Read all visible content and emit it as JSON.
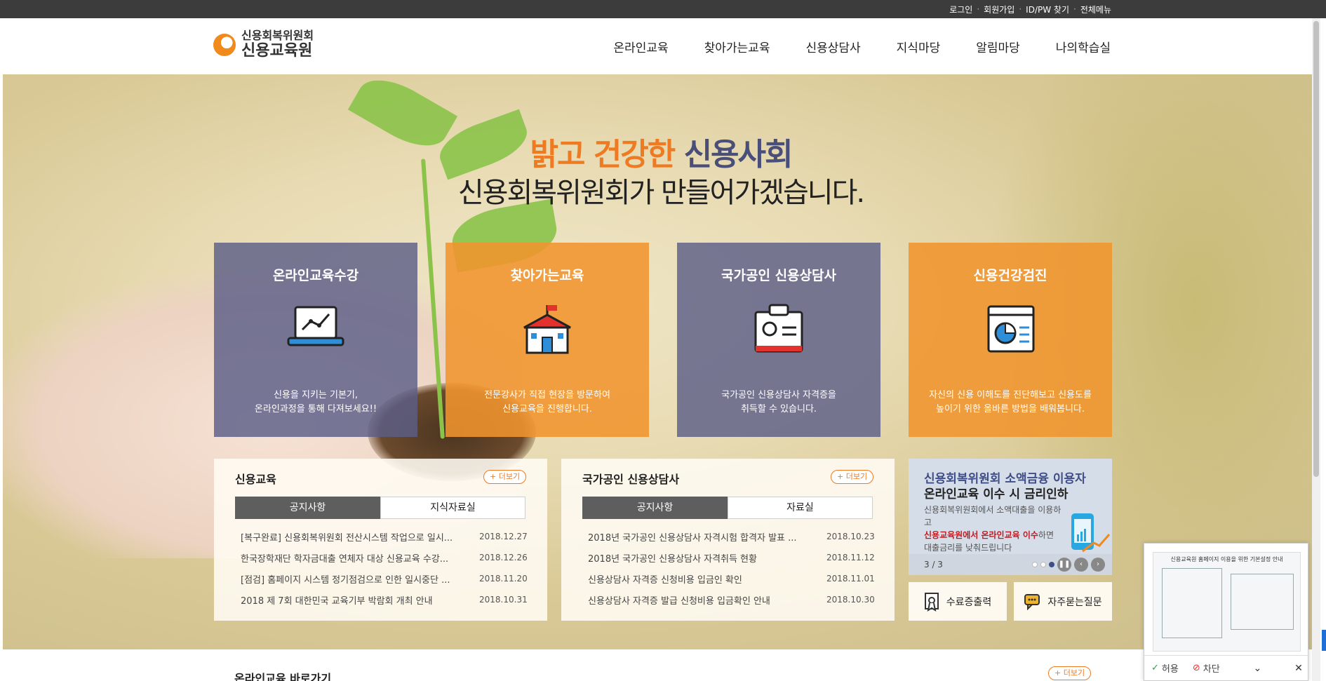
{
  "top_links": [
    "로그인",
    "회원가입",
    "ID/PW 찾기",
    "전체메뉴"
  ],
  "logo": {
    "line1": "신용회복위원회",
    "line2": "신용교육원"
  },
  "nav": [
    "온라인교육",
    "찾아가는교육",
    "신용상담사",
    "지식마당",
    "알림마당",
    "나의학습실"
  ],
  "hero": {
    "slogan_orange": "밝고 건강한",
    "slogan_blue": "신용사회",
    "slogan_line2": "신용회복위원회가 만들어가겠습니다."
  },
  "cards": [
    {
      "title": "온라인교육수강",
      "desc1": "신용을 지키는 기본기,",
      "desc2": "온라인과정을 통해 다져보세요!!",
      "icon": "laptop-icon"
    },
    {
      "title": "찾아가는교육",
      "desc1": "전문강사가 직접 현장을 방문하여",
      "desc2": "신용교육을 진행합니다.",
      "icon": "school-icon"
    },
    {
      "title": "국가공인 신용상담사",
      "desc1": "국가공인 신용상담사 자격증을",
      "desc2": "취득할 수 있습니다.",
      "icon": "id-card-icon"
    },
    {
      "title": "신용건강검진",
      "desc1": "자신의 신용 이해도를 진단해보고 신용도를",
      "desc2": "높이기 위한 올바른 방법을 배워봅니다.",
      "icon": "pie-report-icon"
    }
  ],
  "panel1": {
    "title": "신용교육",
    "more": "+ 더보기",
    "tabs": [
      "공지사항",
      "지식자료실"
    ],
    "rows": [
      {
        "title": "[복구완료] 신용회복위원회 전산시스템 작업으로 일시...",
        "date": "2018.12.27"
      },
      {
        "title": "한국장학재단 학자금대출 연체자 대상 신용교육 수강...",
        "date": "2018.12.26"
      },
      {
        "title": "[점검] 홈페이지 시스템 정기점검으로 인한 일시중단 ...",
        "date": "2018.11.20"
      },
      {
        "title": "2018 제 7회 대한민국 교육기부 박람회 개최 안내",
        "date": "2018.10.31"
      }
    ]
  },
  "panel2": {
    "title": "국가공인 신용상담사",
    "more": "+ 더보기",
    "tabs": [
      "공지사항",
      "자료실"
    ],
    "rows": [
      {
        "title": "2018년 국가공인 신용상담사 자격시험 합격자 발표 ...",
        "date": "2018.10.23"
      },
      {
        "title": "2018년 국가공인 신용상담사 자격취득 현황",
        "date": "2018.11.12"
      },
      {
        "title": "신용상담사 자격증 신청비용 입금인 확인",
        "date": "2018.11.01"
      },
      {
        "title": "신용상담사 자격증 발급 신청비용 입금확인 안내",
        "date": "2018.10.30"
      }
    ]
  },
  "promo": {
    "line1": "신용회복위원회 소액금융 이용자",
    "line2": "온라인교육 이수 시 금리인하",
    "desc1": "신용회복위원회에서 소액대출을 이용하고",
    "desc_red": "신용교육원에서 온라인교육 이수",
    "desc2": "하면",
    "desc3": "대출금리를 낮춰드립니다",
    "page": "3 / 3"
  },
  "quick_buttons": [
    "수료증출력",
    "자주묻는질문"
  ],
  "quick_section": {
    "title": "온라인교육 바로가기",
    "more": "+ 더보기"
  },
  "popup": {
    "thumb_title": "신용교육원 홈페이지 이용을 위한 기본설정 안내",
    "allow": "허용",
    "block": "차단"
  },
  "colors": {
    "orange": "#ee7a22",
    "purple": "#5c5e88",
    "dark": "#3c3c3c"
  }
}
